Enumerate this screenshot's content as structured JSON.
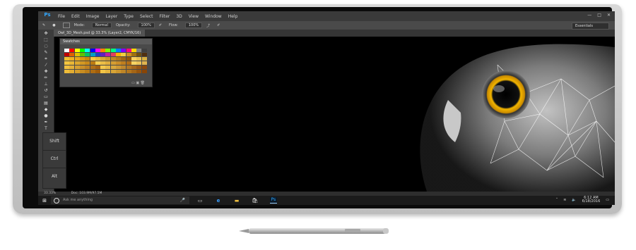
{
  "menubar": {
    "logo": "Ps",
    "items": [
      "File",
      "Edit",
      "Image",
      "Layer",
      "Type",
      "Select",
      "Filter",
      "3D",
      "View",
      "Window",
      "Help"
    ],
    "controls": [
      "—",
      "□",
      "✕"
    ]
  },
  "options": {
    "mode_label": "Mode:",
    "mode_value": "Normal",
    "opacity_label": "Opacity:",
    "opacity_value": "100%",
    "flow_label": "Flow:",
    "flow_value": "100%",
    "workspace": "Essentials"
  },
  "document": {
    "tab_title": "Owl_3D_Mesh.psd @ 33.3% (Layer2, CMYK/16)"
  },
  "swatches": {
    "title": "Swatches",
    "colors": [
      [
        "#ffffff",
        "#ff0000",
        "#ffff00",
        "#00ff00",
        "#00ffff",
        "#0000ff",
        "#ff00ff",
        "#ff8000",
        "#80ff00",
        "#00ff80",
        "#0080ff",
        "#8000ff",
        "#ff0080",
        "#ffd700",
        "#808080",
        "#404040"
      ],
      [
        "#c00000",
        "#e06000",
        "#e0c000",
        "#60c000",
        "#00c060",
        "#00a0c0",
        "#2040c0",
        "#6020c0",
        "#c020a0",
        "#e04060",
        "#ffb000",
        "#f0d040",
        "#d09020",
        "#a07010",
        "#705010",
        "#503010"
      ],
      [
        "#f2c230",
        "#f0b020",
        "#e8a818",
        "#d89810",
        "#c88808",
        "#f5c842",
        "#e7b83a",
        "#d9a832",
        "#cb982a",
        "#bd8822",
        "#af781a",
        "#a16812",
        "#93580a",
        "#f8d060",
        "#e8c050",
        "#d8b040"
      ],
      [
        "#f4c63e",
        "#e9b735",
        "#dea82c",
        "#d39923",
        "#c88a1a",
        "#bd7b11",
        "#f6ce50",
        "#ebbe46",
        "#e0ae3c",
        "#d59e32",
        "#ca8e28",
        "#bf7e1e",
        "#b46e14",
        "#f7d462",
        "#ecc458",
        "#e1b44e"
      ],
      [
        "#f1c040",
        "#e4b038",
        "#d7a030",
        "#ca9028",
        "#bd8020",
        "#b07018",
        "#a36010",
        "#f4c84c",
        "#e7b844",
        "#daa83c",
        "#cd9834",
        "#c0882c",
        "#b37824",
        "#a6681c",
        "#995814",
        "#8c480c"
      ],
      [
        "#efbd3a",
        "#e2ad32",
        "#d59d2a",
        "#c88d22",
        "#bb7d1a",
        "#ae6d12",
        "#a15d0a",
        "#f2c546",
        "#e5b53e",
        "#d8a536",
        "#cb952e",
        "#be8526",
        "#b1751e",
        "#a46516",
        "#97550e",
        "#8a4506"
      ]
    ]
  },
  "keys": [
    "Shift",
    "Ctrl",
    "Alt"
  ],
  "status": {
    "zoom": "33.33%",
    "doc": "Doc: 103.9M/97.5M"
  },
  "taskbar": {
    "search_placeholder": "Ask me anything",
    "time": "6:12 AM",
    "date": "6/18/2016"
  }
}
